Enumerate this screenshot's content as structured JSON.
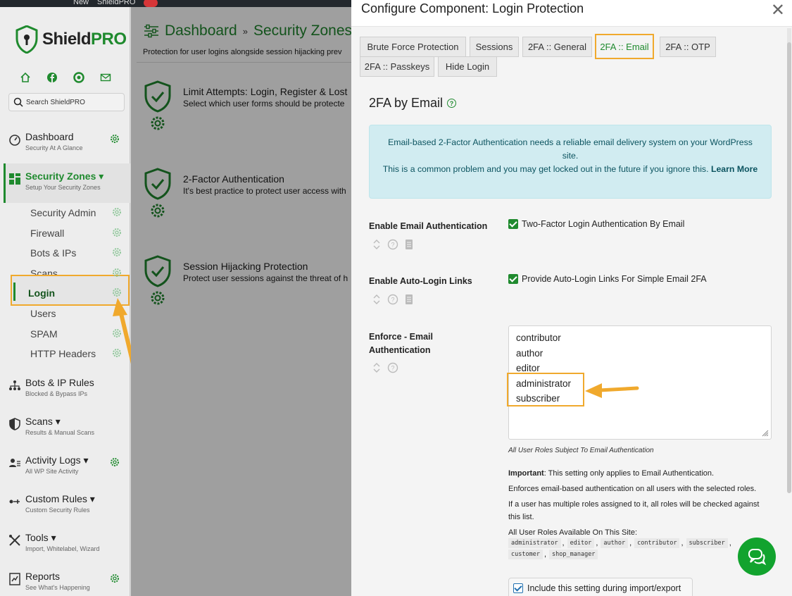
{
  "wp_bar": {
    "new_label": "New",
    "plugin_label": "ShieldPRO"
  },
  "brand": {
    "name_part1": "Shield",
    "name_part2": "PRO"
  },
  "sidebar": {
    "search_placeholder": "Search ShieldPRO",
    "quick_icons": [
      "home-icon",
      "facebook-icon",
      "support-icon",
      "mail-icon"
    ],
    "main_items": [
      {
        "title": "Dashboard",
        "sub": "Security At A Glance",
        "icon": "dashboard-icon",
        "gear": true
      },
      {
        "title": "Security Zones ▾",
        "sub": "Setup Your Security Zones",
        "icon": "zones-icon",
        "gear": false
      },
      {
        "title": "Bots & IP Rules",
        "sub": "Blocked & Bypass IPs",
        "icon": "network-icon",
        "gear": false
      },
      {
        "title": "Scans ▾",
        "sub": "Results & Manual Scans",
        "icon": "shield-half-icon",
        "gear": false
      },
      {
        "title": "Activity Logs ▾",
        "sub": "All WP Site Activity",
        "icon": "users-icon",
        "gear": true
      },
      {
        "title": "Custom Rules ▾",
        "sub": "Custom Security Rules",
        "icon": "rules-icon",
        "gear": false
      },
      {
        "title": "Tools ▾",
        "sub": "Import, Whitelabel, Wizard",
        "icon": "tools-icon",
        "gear": false
      },
      {
        "title": "Reports",
        "sub": "See What's Happening",
        "icon": "reports-icon",
        "gear": true
      }
    ],
    "sub_items": [
      "Security Admin",
      "Firewall",
      "Bots & IPs",
      "Scans",
      "Login",
      "Users",
      "SPAM",
      "HTTP Headers"
    ]
  },
  "main": {
    "breadcrumb": [
      "Dashboard",
      "»",
      "Security Zones"
    ],
    "subtitle": "Protection for user logins alongside session hijacking prev",
    "features": [
      {
        "title": "Limit Attempts: Login, Register & Lost",
        "desc": "Select which user forms should be protecte"
      },
      {
        "title": "2-Factor Authentication",
        "desc": "It's best practice to protect user access with"
      },
      {
        "title": "Session Hijacking Protection",
        "desc": "Protect user sessions against the threat of h"
      }
    ]
  },
  "modal": {
    "title": "Configure Component: Login Protection",
    "tabs": [
      "Brute Force Protection",
      "Sessions",
      "2FA :: General",
      "2FA :: Email",
      "2FA :: OTP",
      "2FA :: Passkeys",
      "Hide Login"
    ],
    "active_tab": "2FA :: Email",
    "section_title": "2FA by Email",
    "notice": {
      "line1": "Email-based 2-Factor Authentication needs a reliable email delivery system on your WordPress site.",
      "line2": "This is a common problem and you may get locked out in the future if you ignore this.",
      "link": "Learn More"
    },
    "settings": [
      {
        "label": "Enable Email Authentication",
        "checkbox_label": "Two-Factor Login Authentication By Email",
        "checked": true
      },
      {
        "label": "Enable Auto-Login Links",
        "checkbox_label": "Provide Auto-Login Links For Simple Email 2FA",
        "checked": true
      },
      {
        "label": "Enforce - Email Authentication"
      }
    ],
    "roles_options": [
      "contributor",
      "author",
      "editor",
      "administrator",
      "subscriber"
    ],
    "roles_caption": "All User Roles Subject To Email Authentication",
    "important_label": "Important",
    "important_text": ": This setting only applies to Email Authentication.",
    "note2": "Enforces email-based authentication on all users with the selected roles.",
    "note3": "If a user has multiple roles assigned to it, all roles will be checked against this list.",
    "note4": "All User Roles Available On This Site:",
    "available_roles": [
      "administrator",
      "editor",
      "author",
      "contributor",
      "subscriber",
      "customer",
      "shop_manager"
    ],
    "import_label": "Include this setting during import/export"
  },
  "colors": {
    "accent": "#1f8a2e",
    "highlight": "#f0a92d",
    "notice_bg": "#d1ecf1"
  }
}
